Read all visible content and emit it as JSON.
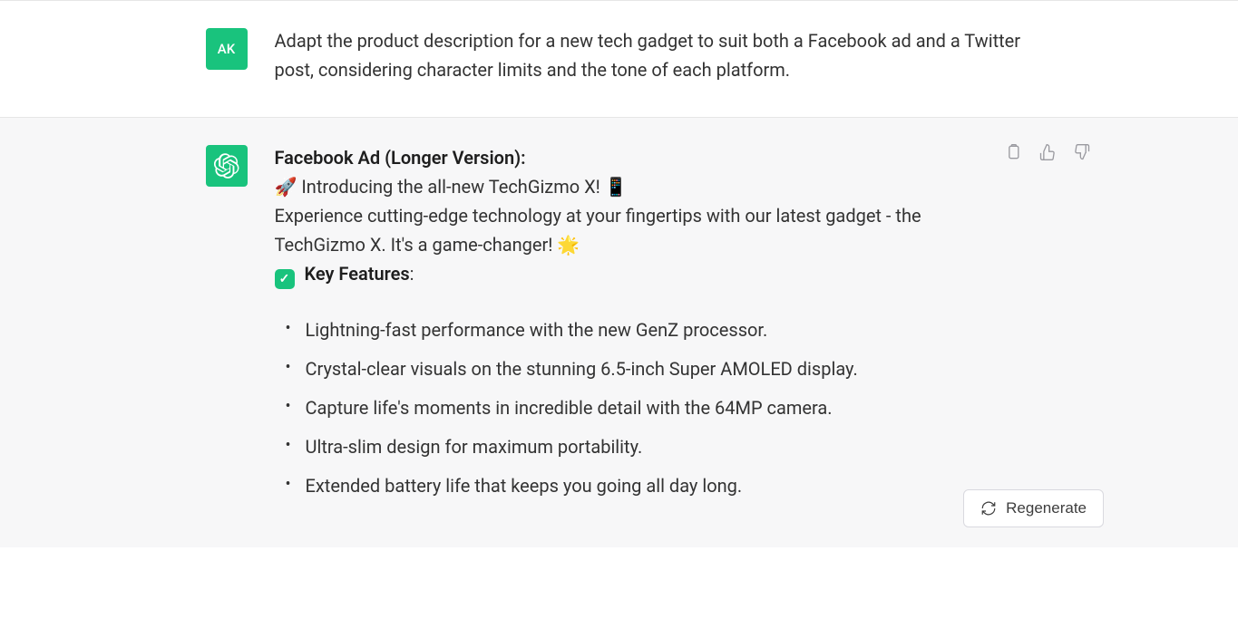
{
  "user": {
    "initials": "AK",
    "message": "Adapt the product description for a new tech gadget to suit both a Facebook ad and a Twitter post, considering character limits and the tone of each platform."
  },
  "assistant": {
    "heading": "Facebook Ad (Longer Version):",
    "intro_line": "🚀 Introducing the all-new TechGizmo X! 📱",
    "body": "Experience cutting-edge technology at your fingertips with our latest gadget - the TechGizmo X. It's a game-changer! 🌟",
    "features_label": "Key Features",
    "features_colon": ":",
    "features": [
      "Lightning-fast performance with the new GenZ processor.",
      "Crystal-clear visuals on the stunning 6.5-inch Super AMOLED display.",
      "Capture life's moments in incredible detail with the 64MP camera.",
      "Ultra-slim design for maximum portability.",
      "Extended battery life that keeps you going all day long."
    ]
  },
  "actions": {
    "copy": "Copy",
    "like": "Like",
    "dislike": "Dislike",
    "regenerate": "Regenerate"
  }
}
